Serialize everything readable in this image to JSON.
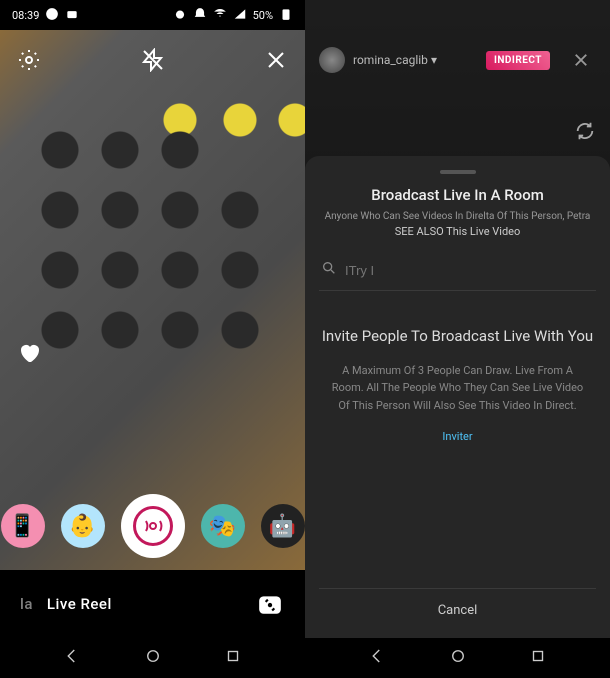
{
  "status": {
    "time": "08:39",
    "battery": "50%"
  },
  "screen1": {
    "mode_secondary": "la",
    "mode_primary": "Live Reel"
  },
  "screen2": {
    "username": "romina_caglib",
    "badge": "INDIRECT",
    "sheet": {
      "title": "Broadcast Live In A Room",
      "sub1": "Anyone Who Can See Videos In Direlta Of This Person, Petra",
      "sub2": "SEE ALSO This Live Video",
      "search_placeholder": "ITry I",
      "invite_title": "Invite People To Broadcast Live With You",
      "invite_body": "A Maximum Of 3 People Can Draw. Live From A Room. All The People Who They Can See Live Video Of This Person Will Also See This Video In Direct.",
      "invite_link": "Inviter",
      "cancel": "Cancel"
    }
  }
}
